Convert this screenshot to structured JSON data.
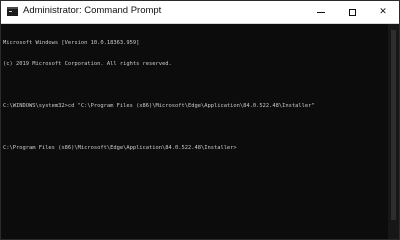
{
  "window": {
    "title": "Administrator: Command Prompt",
    "controls": {
      "minimize_icon": "minimize-icon",
      "maximize_icon": "maximize-icon",
      "close_icon": "close-icon",
      "close_glyph": "✕"
    }
  },
  "console": {
    "lines": [
      "Microsoft Windows [Version 10.0.18363.959]",
      "(c) 2019 Microsoft Corporation. All rights reserved.",
      "C:\\WINDOWS\\system32>cd \"C:\\Program Files (x86)\\Microsoft\\Edge\\Application\\84.0.522.48\\Installer\"",
      "C:\\Program Files (x86)\\Microsoft\\Edge\\Application\\84.0.522.48\\Installer>"
    ]
  },
  "colors": {
    "console_background": "#0c0c0c",
    "console_text": "#cccccc",
    "titlebar_background": "#ffffff"
  }
}
